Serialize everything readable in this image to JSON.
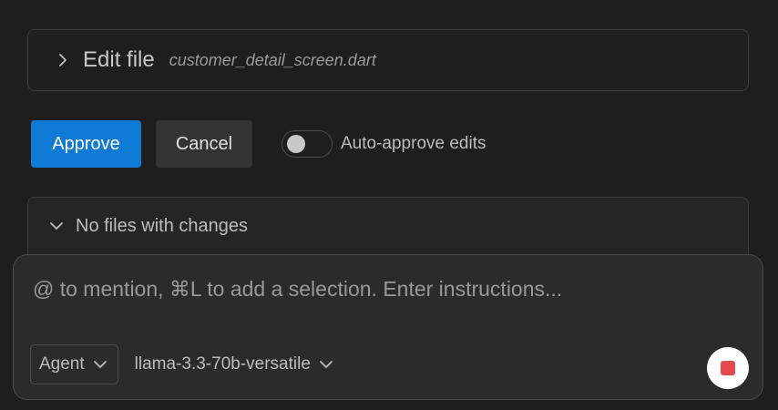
{
  "edit_card": {
    "label": "Edit file",
    "filename": "customer_detail_screen.dart",
    "icon": "chevron-right-icon"
  },
  "actions": {
    "approve_label": "Approve",
    "cancel_label": "Cancel",
    "auto_approve_label": "Auto-approve edits",
    "auto_approve_on": false
  },
  "changes": {
    "label": "No files with changes",
    "icon": "chevron-down-icon"
  },
  "chat_input": {
    "placeholder": "@ to mention, ⌘L to add a selection. Enter instructions...",
    "mode": "Agent",
    "model": "llama-3.3-70b-versatile"
  },
  "colors": {
    "background": "#1e1e1e",
    "accent": "#0e7ad6",
    "stop": "#e5484d"
  }
}
